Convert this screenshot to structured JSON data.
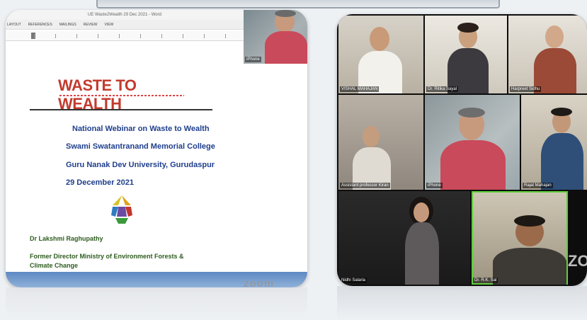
{
  "slide": {
    "window_title": "UE Waste2Wealth 29 Dec 2021 - Word",
    "ribbon_tabs": [
      "LAYOUT",
      "REFERENCES",
      "MAILINGS",
      "REVIEW",
      "VIEW"
    ],
    "title": "WASTE TO WEALTH",
    "lines": [
      "National Webinar on Waste to Wealth",
      "Swami Swatantranand Memorial College",
      "Guru Nanak Dev University, Gurudaspur",
      "29 December 2021"
    ],
    "author": "Dr Lakshmi Raghupathy",
    "author_role": "Former Director Ministry of Environment Forests & Climate Change",
    "speaker_thumbnail_label": "iPhone",
    "watermark": "zoom"
  },
  "gallery": {
    "tiles": [
      {
        "name": "VISHAL MAHAJAN"
      },
      {
        "name": "Dr. Ritika Sayal"
      },
      {
        "name": "Harpreet Sidhu"
      },
      {
        "name": "Assistant professor Kiran"
      },
      {
        "name": "iPhone"
      },
      {
        "name": "Rajat Mahajan"
      },
      {
        "name": "Nidhi Salaria"
      },
      {
        "name": "Dr. R.K. Sal"
      }
    ],
    "watermark": "ZOO"
  },
  "colors": {
    "title_red": "#c33b2f",
    "body_blue": "#1f3f8c",
    "author_green": "#2e5c1e",
    "active_speaker": "#5fcf3a"
  }
}
